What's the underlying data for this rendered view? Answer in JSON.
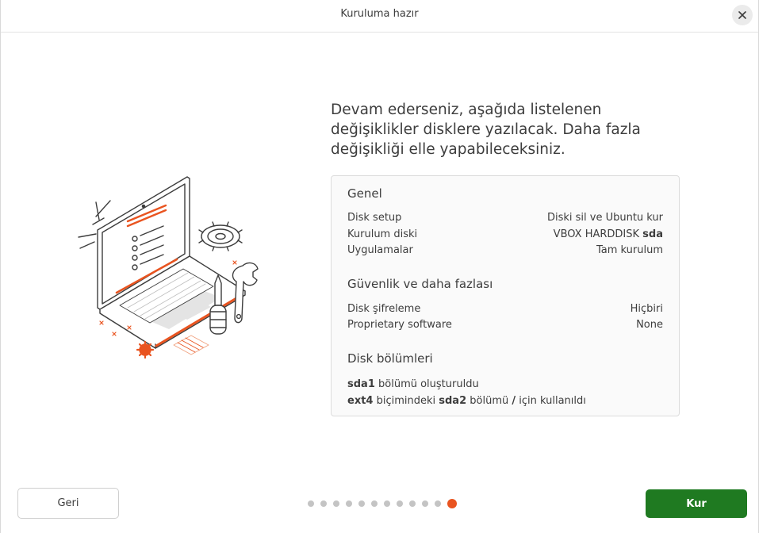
{
  "window": {
    "title": "Kuruluma hazır"
  },
  "heading": "Devam ederseniz, aşağıda listelenen değişiklikler disklere yazılacak. Daha fazla değişikliği elle yapabileceksiniz.",
  "summary": {
    "general": {
      "title": "Genel",
      "rows": [
        {
          "label": "Disk setup",
          "value": "Diski sil ve Ubuntu kur"
        },
        {
          "label": "Kurulum diski",
          "value_prefix": "VBOX HARDDISK ",
          "value_bold": "sda"
        },
        {
          "label": "Uygulamalar",
          "value": "Tam kurulum"
        }
      ]
    },
    "security": {
      "title": "Güvenlik ve daha fazlası",
      "rows": [
        {
          "label": "Disk şifreleme",
          "value": "Hiçbiri"
        },
        {
          "label": "Proprietary software",
          "value": "None"
        }
      ]
    },
    "partitions": {
      "title": "Disk bölümleri",
      "line1": {
        "b1": "sda1",
        "t1": " bölümü oluşturuldu"
      },
      "line2": {
        "b1": "ext4",
        "t1": " biçimindeki ",
        "b2": "sda2",
        "t2": " bölümü ",
        "b3": "/",
        "t3": " için kullanıldı"
      }
    }
  },
  "buttons": {
    "back": "Geri",
    "install": "Kur"
  },
  "progress": {
    "total_steps": 12,
    "current_step": 12
  },
  "colors": {
    "accent": "#e95420",
    "install_button": "#1f7a21",
    "dot_inactive": "#c4c4c4"
  },
  "icons": {
    "close": "close-icon"
  }
}
